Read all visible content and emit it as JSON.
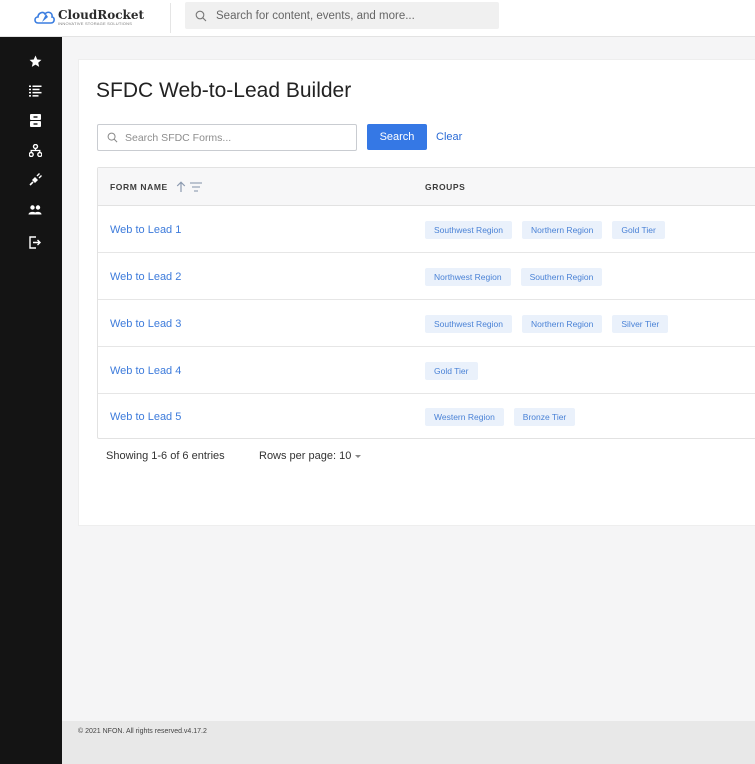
{
  "brand": {
    "name": "CloudRocket",
    "tagline": "INNOVATIVE STORAGE SOLUTIONS",
    "primary_color": "#3578e5",
    "logo_color": "#3a7de0"
  },
  "topbar": {
    "search_placeholder": "Search for content, events, and more..."
  },
  "sidebar": {
    "items": [
      {
        "icon": "star-icon"
      },
      {
        "icon": "list-icon"
      },
      {
        "icon": "archive-icon"
      },
      {
        "icon": "hierarchy-icon"
      },
      {
        "icon": "plug-icon"
      },
      {
        "icon": "users-icon"
      },
      {
        "icon": "logout-icon"
      }
    ]
  },
  "page": {
    "title": "SFDC Web-to-Lead Builder"
  },
  "search": {
    "placeholder": "Search SFDC Forms...",
    "search_label": "Search",
    "clear_label": "Clear"
  },
  "table": {
    "columns": [
      "FORM NAME",
      "GROUPS"
    ],
    "rows": [
      {
        "name": "Web to Lead 1",
        "groups": [
          "Southwest Region",
          "Northern Region",
          "Gold Tier"
        ]
      },
      {
        "name": "Web to Lead 2",
        "groups": [
          "Northwest Region",
          "Southern Region"
        ]
      },
      {
        "name": "Web to Lead 3",
        "groups": [
          "Southwest Region",
          "Northern Region",
          "Silver Tier"
        ]
      },
      {
        "name": "Web to Lead 4",
        "groups": [
          "Gold Tier"
        ]
      },
      {
        "name": "Web to Lead 5",
        "groups": [
          "Western Region",
          "Bronze Tier"
        ]
      }
    ]
  },
  "pagination": {
    "info": "Showing 1-6 of 6 entries",
    "rows_per_page_label": "Rows per page: 10"
  },
  "footer": {
    "text": "© 2021 NFON. All rights reserved.v4.17.2"
  }
}
